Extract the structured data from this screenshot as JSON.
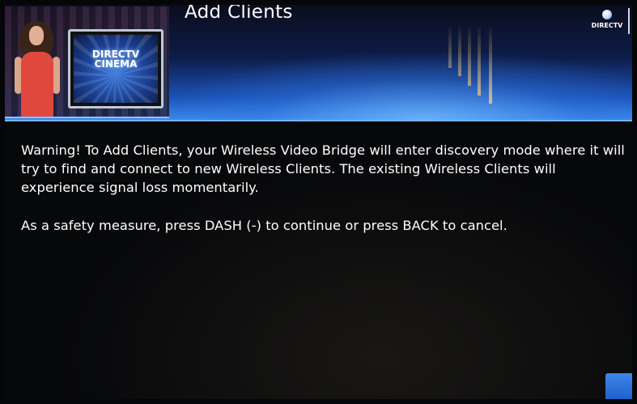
{
  "header": {
    "title": "Add Clients",
    "brand": "DIRECTV",
    "video_logo": "DIRECTV CINEMA"
  },
  "message": {
    "warning": "Warning! To Add Clients, your Wireless Video Bridge will enter discovery mode where it will try to find and connect to new Wireless Clients. The existing Wireless Clients will experience signal loss momentarily.",
    "instruction": "As a safety measure, press DASH (-) to continue or press BACK to cancel."
  },
  "colors": {
    "header_blue": "#1b52b6",
    "accent_line": "#6fb4ff",
    "text": "#ffffff",
    "background": "#07080a"
  },
  "icons": [
    "att-globe-icon",
    "corner-button-icon"
  ]
}
